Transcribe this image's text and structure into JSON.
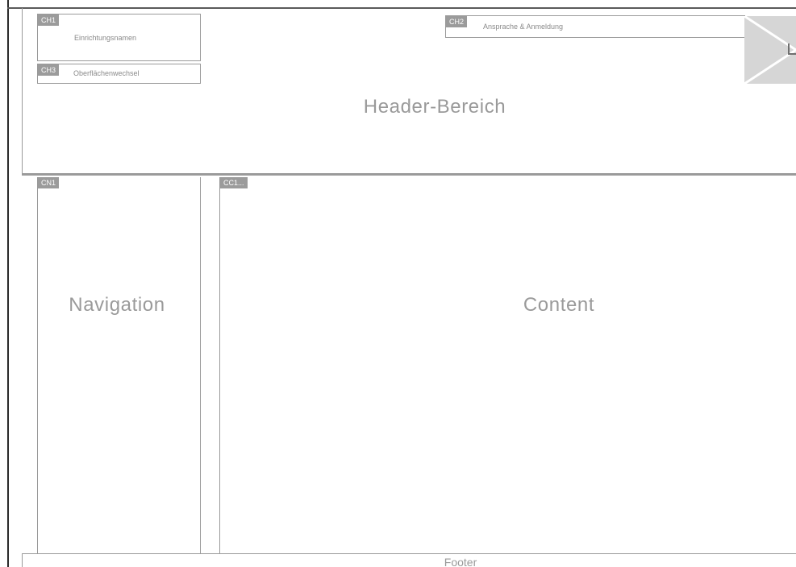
{
  "header": {
    "title": "Header-Bereich",
    "ch1": {
      "tag": "CH1",
      "label": "Einrichtungsnamen"
    },
    "ch2": {
      "tag": "CH2",
      "label": "Ansprache & Anmeldung"
    },
    "ch3": {
      "tag": "CH3",
      "label": "Oberflächenwechsel"
    }
  },
  "navigation": {
    "tag": "CN1",
    "label": "Navigation"
  },
  "content": {
    "tag": "CC1...",
    "label": "Content"
  },
  "footer": {
    "label": "Footer"
  },
  "colors": {
    "wireframe_line": "#9a9a9a",
    "tag_background": "#9b9b9b",
    "text_gray": "#9a9a9a",
    "logo_fill": "#d6d6d6"
  }
}
